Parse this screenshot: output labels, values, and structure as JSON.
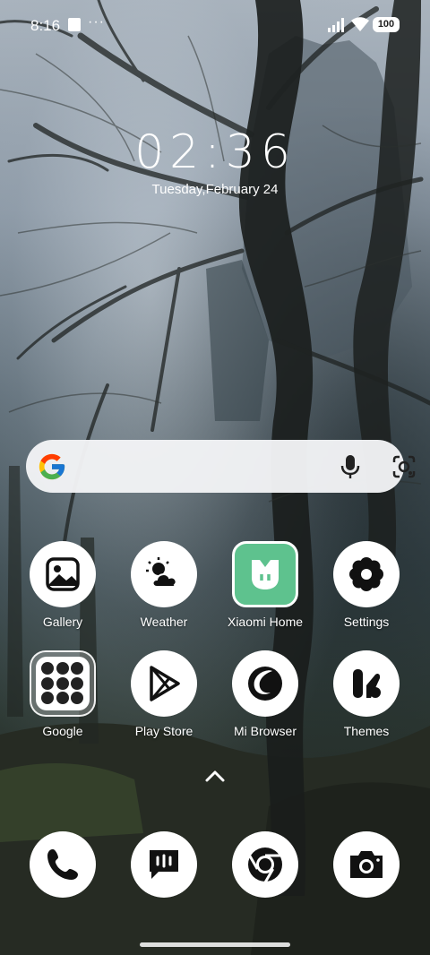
{
  "status_bar": {
    "time": "8:16",
    "more": "···",
    "battery": "100"
  },
  "clock": {
    "time": "02:36",
    "date": "Tuesday,February 24"
  },
  "search": {
    "google_icon": "google-g-icon",
    "mic_icon": "microphone-icon",
    "lens_icon": "google-lens-icon"
  },
  "apps": {
    "row1": [
      {
        "label": "Gallery",
        "icon": "gallery-icon"
      },
      {
        "label": "Weather",
        "icon": "weather-icon"
      },
      {
        "label": "Xiaomi Home",
        "icon": "xiaomi-home-icon"
      },
      {
        "label": "Settings",
        "icon": "gear-icon"
      }
    ],
    "row2": [
      {
        "label": "Google",
        "icon": "google-folder-icon"
      },
      {
        "label": "Play Store",
        "icon": "play-store-icon"
      },
      {
        "label": "Mi Browser",
        "icon": "browser-icon"
      },
      {
        "label": "Themes",
        "icon": "themes-icon"
      }
    ]
  },
  "dock": [
    {
      "icon": "phone-icon"
    },
    {
      "icon": "messages-icon"
    },
    {
      "icon": "chrome-icon"
    },
    {
      "icon": "camera-icon"
    }
  ]
}
